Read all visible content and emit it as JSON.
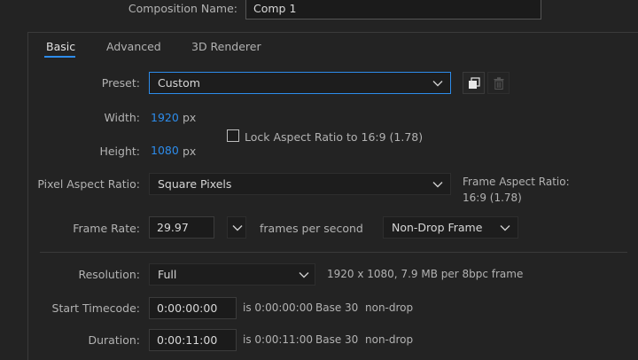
{
  "composition": {
    "name_label": "Composition Name:",
    "name_value": "Comp 1"
  },
  "tabs": [
    {
      "label": "Basic",
      "active": true
    },
    {
      "label": "Advanced",
      "active": false
    },
    {
      "label": "3D Renderer",
      "active": false
    }
  ],
  "preset": {
    "label": "Preset:",
    "value": "Custom"
  },
  "width": {
    "label": "Width:",
    "value": "1920",
    "unit": "px"
  },
  "height": {
    "label": "Height:",
    "value": "1080",
    "unit": "px"
  },
  "lock_aspect": {
    "label": "Lock Aspect Ratio to 16:9 (1.78)",
    "checked": false
  },
  "pixel_aspect": {
    "label": "Pixel Aspect Ratio:",
    "value": "Square Pixels"
  },
  "frame_aspect": {
    "label": "Frame Aspect Ratio:",
    "value": "16:9 (1.78)"
  },
  "frame_rate": {
    "label": "Frame Rate:",
    "value": "29.97",
    "unit": "frames per second",
    "drop_mode": "Non-Drop Frame"
  },
  "resolution": {
    "label": "Resolution:",
    "value": "Full",
    "info": "1920 x 1080, 7.9 MB per 8bpc frame"
  },
  "start_timecode": {
    "label": "Start Timecode:",
    "value": "0:00:00:00",
    "is_text": "is 0:00:00:00",
    "base": "Base 30",
    "mode": "non-drop"
  },
  "duration": {
    "label": "Duration:",
    "value": "0:00:11:00",
    "is_text": "is 0:00:11:00",
    "base": "Base 30",
    "mode": "non-drop"
  },
  "colors": {
    "accent": "#2d8ceb",
    "background": "#232323",
    "field": "#1b1b1b"
  }
}
